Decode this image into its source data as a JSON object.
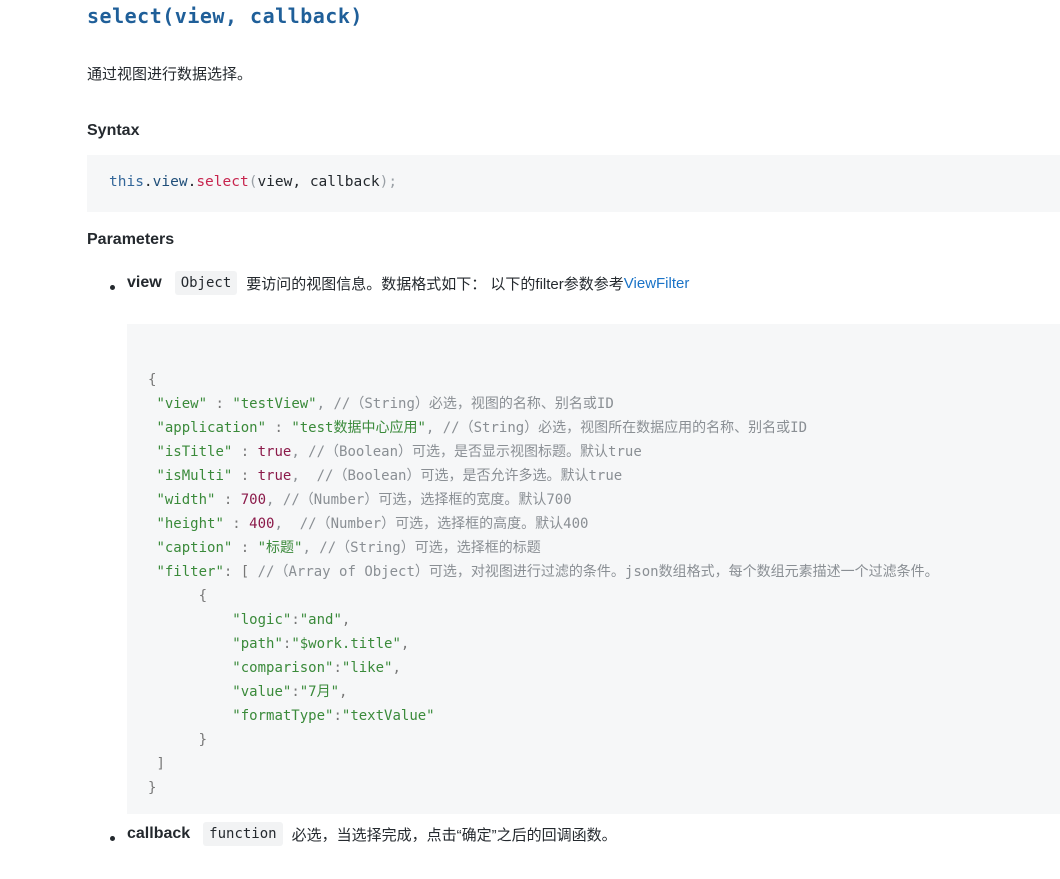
{
  "title": "select(view, callback)",
  "description": "通过视图进行数据选择。",
  "syntax": {
    "heading": "Syntax",
    "code": {
      "this": "this",
      "view": "view",
      "method": "select",
      "open": "(",
      "args": "view, callback",
      "close": ");"
    }
  },
  "parameters": {
    "heading": "Parameters",
    "items": [
      {
        "name": "view",
        "type": "Object",
        "description": "要访问的视图信息。数据格式如下： 以下的filter参数参考",
        "link_text": "ViewFilter"
      },
      {
        "name": "callback",
        "type": "function",
        "description": "必选，当选择完成，点击“确定”之后的回调函数。"
      }
    ]
  },
  "code_block": {
    "open_brace": "{",
    "lines": [
      {
        "key": "\"view\"",
        "sep": " : ",
        "value": "\"testView\"",
        "vtype": "s",
        "comment": ", //（String）必选，视图的名称、别名或ID"
      },
      {
        "key": "\"application\"",
        "sep": " : ",
        "value": "\"test数据中心应用\"",
        "vtype": "s",
        "comment": ", //（String）必选，视图所在数据应用的名称、别名或ID"
      },
      {
        "key": "\"isTitle\"",
        "sep": " : ",
        "value": "true",
        "vtype": "n",
        "comment": ", //（Boolean）可选，是否显示视图标题。默认true"
      },
      {
        "key": "\"isMulti\"",
        "sep": " : ",
        "value": "true",
        "vtype": "n",
        "comment": ",  //（Boolean）可选，是否允许多选。默认true"
      },
      {
        "key": "\"width\"",
        "sep": " : ",
        "value": "700",
        "vtype": "n",
        "comment": ", //（Number）可选，选择框的宽度。默认700"
      },
      {
        "key": "\"height\"",
        "sep": " : ",
        "value": "400",
        "vtype": "n",
        "comment": ",  //（Number）可选，选择框的高度。默认400"
      },
      {
        "key": "\"caption\"",
        "sep": " : ",
        "value": "\"标题\"",
        "vtype": "s",
        "comment": ", //（String）可选，选择框的标题"
      },
      {
        "key": "\"filter\"",
        "sep": ": ",
        "value": "[",
        "vtype": "p",
        "comment": " //（Array of Object）可选，对视图进行过滤的条件。json数组格式，每个数组元素描述一个过滤条件。"
      }
    ],
    "inner_open": "{",
    "inner_lines": [
      {
        "key": "\"logic\"",
        "value": "\"and\"",
        "trail": ","
      },
      {
        "key": "\"path\"",
        "value": "\"$work.title\"",
        "trail": ","
      },
      {
        "key": "\"comparison\"",
        "value": "\"like\"",
        "trail": ","
      },
      {
        "key": "\"value\"",
        "value": "\"7月\"",
        "trail": ","
      },
      {
        "key": "\"formatType\"",
        "value": "\"textValue\"",
        "trail": ""
      }
    ],
    "inner_close": "}",
    "array_close": "]",
    "close_brace": "}"
  }
}
